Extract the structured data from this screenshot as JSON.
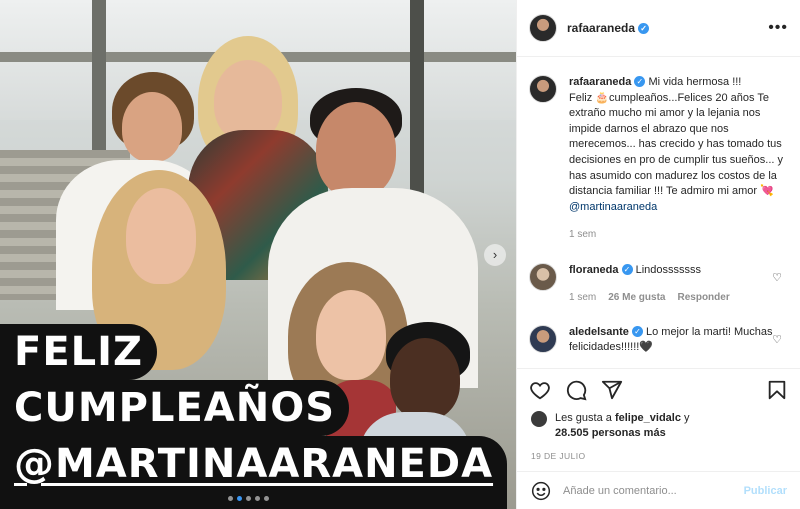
{
  "post": {
    "username": "rafaaraneda",
    "more_icon": "ellipsis-icon"
  },
  "photo": {
    "overlay_lines": [
      "FELIZ",
      "CUMPLEAÑOS",
      "@MARTINAARANEDA"
    ]
  },
  "caption": {
    "username": "rafaaraneda",
    "text_parts": [
      "Mi vida hermosa !!!",
      "Feliz 🎂cumpleaños...Felices 20 años Te extraño mucho mi amor y la lejania nos impide darnos el abrazo que nos merecemos... has crecido y has tomado tus decisiones en pro de cumplir tus sueños... y has asumido con madurez los costos de la distancia familiar !!! Te admiro mi amor 💘"
    ],
    "mention": "@martinaaraneda",
    "time": "1 sem"
  },
  "comments": [
    {
      "username": "floraneda",
      "text": "Lindosssssss",
      "time": "1 sem",
      "likes": "26 Me gusta",
      "reply": "Responder"
    },
    {
      "username": "aledelsante",
      "text": "Lo mejor la marti! Muchas felicidades!!!!!!🖤",
      "time": "",
      "likes": "",
      "reply": ""
    }
  ],
  "likes": {
    "prefix": "Les gusta a",
    "user": "felipe_vidalc",
    "joiner": "y",
    "count": "28.505 personas más"
  },
  "date": "19 DE JULIO",
  "add_comment": {
    "placeholder": "Añade un comentario...",
    "publish": "Publicar"
  },
  "colors": {
    "verified": "#3897f0",
    "link": "#00376b",
    "muted": "#8e8e8e",
    "publish_disabled": "#b2dffc",
    "overlay_bg": "#111111"
  },
  "carousel": {
    "current_index": 1,
    "total": 5
  }
}
